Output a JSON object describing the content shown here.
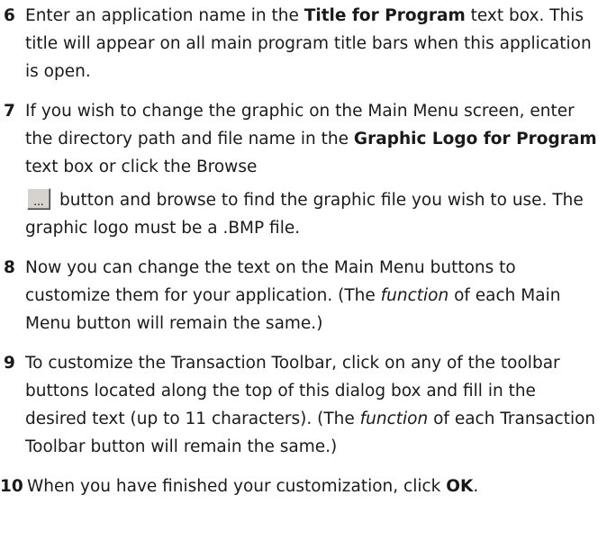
{
  "steps": [
    {
      "number": "6",
      "t1": "Enter an application name in the ",
      "b1": "Title for Program",
      "t2": " text box. This title will appear on all main program title bars when this application is open."
    },
    {
      "number": "7",
      "t1": "If you wish to change the graphic on the Main Menu screen, enter the directory path and file name in the ",
      "b1": "Graphic Logo for Program",
      "t2": " text box or click the Browse",
      "button_label": "...",
      "t3": "button and browse to find the graphic file you wish to use. The graphic logo must be a .BMP file."
    },
    {
      "number": "8",
      "t1": "Now you can change the text on the Main Menu buttons to customize them for your application. (The ",
      "i1": "function",
      "t2": " of each Main Menu button will remain the same.)"
    },
    {
      "number": "9",
      "t1": "To customize the Transaction Toolbar, click on any of the toolbar buttons located along the top of this dialog box and fill in the desired text (up to 11 characters). (The ",
      "i1": "function",
      "t2": " of each Transaction Toolbar button will remain the same.)"
    },
    {
      "number": "10",
      "t1": "When you have finished your customization, click ",
      "b1": "OK",
      "t2": "."
    }
  ]
}
